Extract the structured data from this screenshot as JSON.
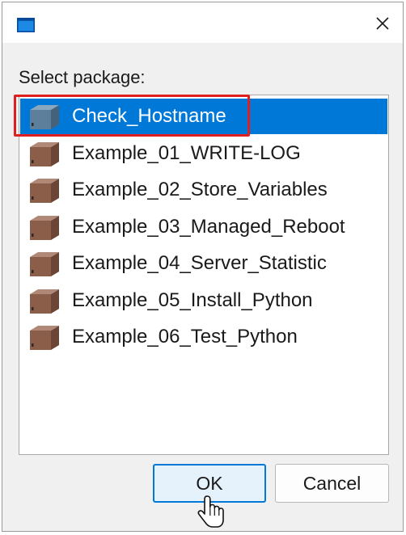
{
  "dialog": {
    "prompt": "Select package:",
    "close_symbol": "×",
    "icons": {
      "app": "window-app-icon",
      "close": "close-icon",
      "package": "package-box-icon",
      "cursor": "hand-pointer-cursor"
    }
  },
  "packages": [
    {
      "label": "Check_Hostname",
      "selected": true
    },
    {
      "label": "Example_01_WRITE-LOG",
      "selected": false
    },
    {
      "label": "Example_02_Store_Variables",
      "selected": false
    },
    {
      "label": "Example_03_Managed_Reboot",
      "selected": false
    },
    {
      "label": "Example_04_Server_Statistic",
      "selected": false
    },
    {
      "label": "Example_05_Install_Python",
      "selected": false
    },
    {
      "label": "Example_06_Test_Python",
      "selected": false
    }
  ],
  "buttons": {
    "ok": "OK",
    "cancel": "Cancel"
  },
  "colors": {
    "selection": "#0078d7",
    "highlight_annotation": "#e02020",
    "package_icon_brown": "#8b5e4a",
    "package_icon_blue": "#5d7f9c"
  }
}
